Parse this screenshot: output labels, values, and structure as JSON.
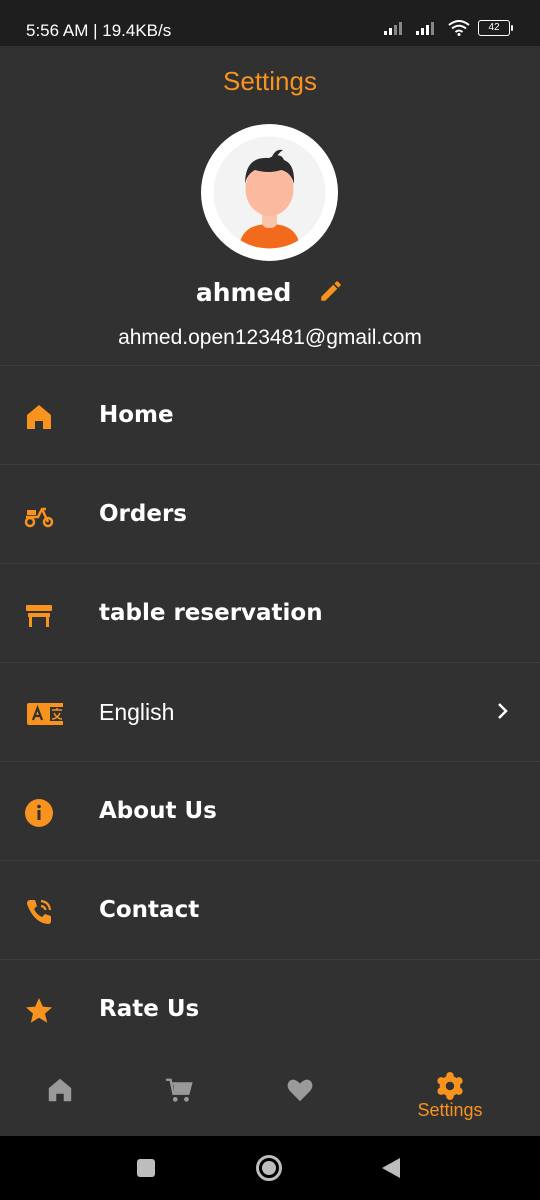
{
  "status_bar": {
    "time": "5:56 AM | 19.4KB/s",
    "battery": "42"
  },
  "header": {
    "title": "Settings"
  },
  "profile": {
    "name": "ahmed",
    "email": "ahmed.open123481@gmail.com"
  },
  "menu": {
    "items": [
      {
        "label": "Home",
        "icon": "home-icon"
      },
      {
        "label": "Orders",
        "icon": "scooter-icon"
      },
      {
        "label": "table reservation",
        "icon": "table-icon"
      },
      {
        "label": "English",
        "icon": "translate-icon"
      },
      {
        "label": "About Us",
        "icon": "info-icon"
      },
      {
        "label": "Contact",
        "icon": "phone-icon"
      },
      {
        "label": "Rate Us",
        "icon": "star-icon"
      }
    ]
  },
  "bottom_nav": {
    "items": [
      {
        "icon": "home-icon"
      },
      {
        "icon": "cart-icon"
      },
      {
        "icon": "heart-icon"
      },
      {
        "icon": "gear-icon",
        "label": "Settings",
        "active": true
      }
    ]
  },
  "colors": {
    "accent": "#f7931e",
    "background": "#313131",
    "divider": "#3e3e3e"
  }
}
